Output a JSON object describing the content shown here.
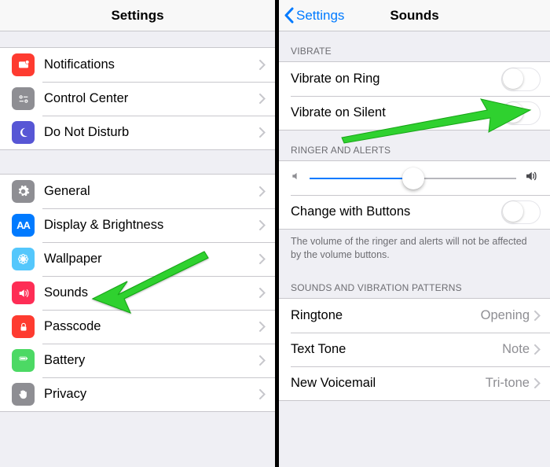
{
  "left": {
    "title": "Settings",
    "group1": [
      {
        "key": "notifications",
        "label": "Notifications",
        "icon_name": "notifications-icon"
      },
      {
        "key": "controlcenter",
        "label": "Control Center",
        "icon_name": "control-center-icon"
      },
      {
        "key": "dnd",
        "label": "Do Not Disturb",
        "icon_name": "moon-icon"
      }
    ],
    "group2": [
      {
        "key": "general",
        "label": "General",
        "icon_name": "gear-icon"
      },
      {
        "key": "display",
        "label": "Display & Brightness",
        "icon_name": "display-icon"
      },
      {
        "key": "wallpaper",
        "label": "Wallpaper",
        "icon_name": "flower-icon"
      },
      {
        "key": "sounds",
        "label": "Sounds",
        "icon_name": "speaker-icon"
      },
      {
        "key": "passcode",
        "label": "Passcode",
        "icon_name": "lock-icon"
      },
      {
        "key": "battery",
        "label": "Battery",
        "icon_name": "battery-icon"
      },
      {
        "key": "privacy",
        "label": "Privacy",
        "icon_name": "hand-icon"
      }
    ]
  },
  "right": {
    "back_label": "Settings",
    "title": "Sounds",
    "vibrate_header": "Vibrate",
    "vibrate_ring_label": "Vibrate on Ring",
    "vibrate_ring_on": false,
    "vibrate_silent_label": "Vibrate on Silent",
    "vibrate_silent_on": false,
    "ringer_header": "Ringer and Alerts",
    "volume_percent": 50,
    "change_buttons_label": "Change with Buttons",
    "change_buttons_on": false,
    "ringer_footer": "The volume of the ringer and alerts will not be affected by the volume buttons.",
    "patterns_header": "Sounds and Vibration Patterns",
    "patterns": [
      {
        "label": "Ringtone",
        "value": "Opening"
      },
      {
        "label": "Text Tone",
        "value": "Note"
      },
      {
        "label": "New Voicemail",
        "value": "Tri-tone"
      }
    ]
  }
}
